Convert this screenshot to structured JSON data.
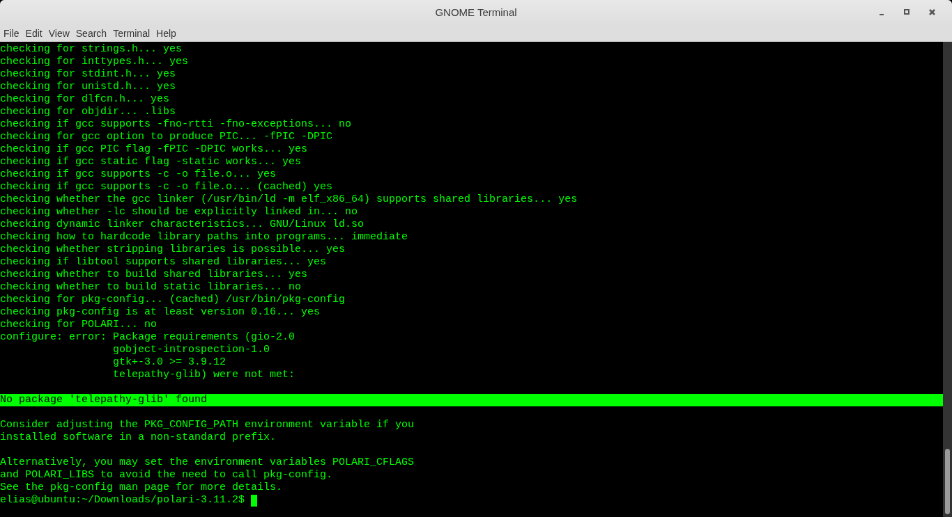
{
  "window": {
    "title": "GNOME Terminal"
  },
  "menu": [
    "File",
    "Edit",
    "View",
    "Search",
    "Terminal",
    "Help"
  ],
  "terminal": {
    "lines": [
      {
        "kind": "output",
        "text": "checking for strings.h... yes"
      },
      {
        "kind": "output",
        "text": "checking for inttypes.h... yes"
      },
      {
        "kind": "output",
        "text": "checking for stdint.h... yes"
      },
      {
        "kind": "output",
        "text": "checking for unistd.h... yes"
      },
      {
        "kind": "output",
        "text": "checking for dlfcn.h... yes"
      },
      {
        "kind": "output",
        "text": "checking for objdir... .libs"
      },
      {
        "kind": "output",
        "text": "checking if gcc supports -fno-rtti -fno-exceptions... no"
      },
      {
        "kind": "output",
        "text": "checking for gcc option to produce PIC... -fPIC -DPIC"
      },
      {
        "kind": "output",
        "text": "checking if gcc PIC flag -fPIC -DPIC works... yes"
      },
      {
        "kind": "output",
        "text": "checking if gcc static flag -static works... yes"
      },
      {
        "kind": "output",
        "text": "checking if gcc supports -c -o file.o... yes"
      },
      {
        "kind": "output",
        "text": "checking if gcc supports -c -o file.o... (cached) yes"
      },
      {
        "kind": "output",
        "text": "checking whether the gcc linker (/usr/bin/ld -m elf_x86_64) supports shared libraries... yes"
      },
      {
        "kind": "output",
        "text": "checking whether -lc should be explicitly linked in... no"
      },
      {
        "kind": "output",
        "text": "checking dynamic linker characteristics... GNU/Linux ld.so"
      },
      {
        "kind": "output",
        "text": "checking how to hardcode library paths into programs... immediate"
      },
      {
        "kind": "output",
        "text": "checking whether stripping libraries is possible... yes"
      },
      {
        "kind": "output",
        "text": "checking if libtool supports shared libraries... yes"
      },
      {
        "kind": "output",
        "text": "checking whether to build shared libraries... yes"
      },
      {
        "kind": "output",
        "text": "checking whether to build static libraries... no"
      },
      {
        "kind": "output",
        "text": "checking for pkg-config... (cached) /usr/bin/pkg-config"
      },
      {
        "kind": "output",
        "text": "checking pkg-config is at least version 0.16... yes"
      },
      {
        "kind": "output",
        "text": "checking for POLARI... no"
      },
      {
        "kind": "output",
        "text": "configure: error: Package requirements (gio-2.0"
      },
      {
        "kind": "output",
        "text": "                  gobject-introspection-1.0"
      },
      {
        "kind": "output",
        "text": "                  gtk+-3.0 >= 3.9.12"
      },
      {
        "kind": "output",
        "text": "                  telepathy-glib) were not met:"
      },
      {
        "kind": "blank"
      },
      {
        "kind": "highlight",
        "text": "No package 'telepathy-glib' found"
      },
      {
        "kind": "blank"
      },
      {
        "kind": "output",
        "text": "Consider adjusting the PKG_CONFIG_PATH environment variable if you"
      },
      {
        "kind": "output",
        "text": "installed software in a non-standard prefix."
      },
      {
        "kind": "blank"
      },
      {
        "kind": "output",
        "text": "Alternatively, you may set the environment variables POLARI_CFLAGS"
      },
      {
        "kind": "output",
        "text": "and POLARI_LIBS to avoid the need to call pkg-config."
      },
      {
        "kind": "output",
        "text": "See the pkg-config man page for more details."
      },
      {
        "kind": "prompt",
        "text": "elias@ubuntu:~/Downloads/polari-3.11.2$"
      }
    ]
  }
}
